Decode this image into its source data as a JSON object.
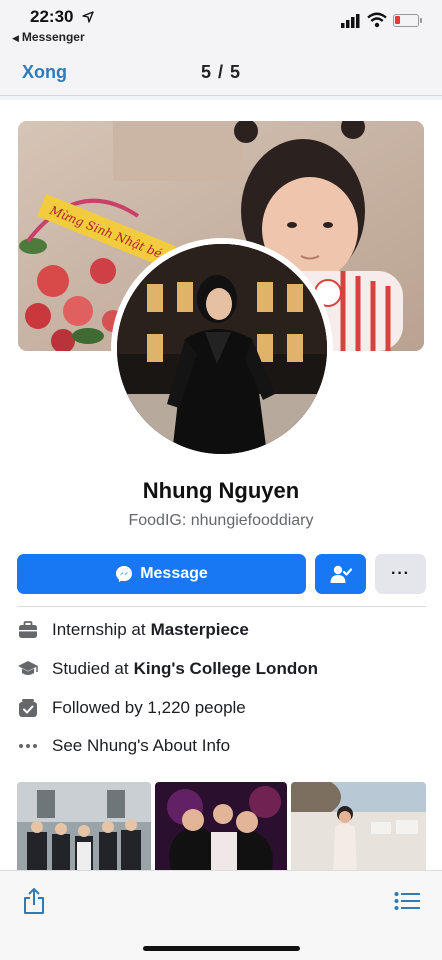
{
  "status_bar": {
    "time": "22:30",
    "back_app": "Messenger"
  },
  "nav": {
    "done_label": "Xong",
    "page_counter": "5 / 5"
  },
  "profile": {
    "name": "Nhung Nguyen",
    "bio": "FoodIG: nhungiefooddiary",
    "cover_banner_text": "Mừng Sinh Nhật bé"
  },
  "actions": {
    "message_label": "Message",
    "more_label": "···"
  },
  "info": {
    "work_prefix": "Internship at",
    "work_place": "Masterpiece",
    "study_prefix": "Studied at",
    "study_place": "King's College London",
    "followers": "Followed by 1,220 people",
    "about": "See Nhung's About Info"
  },
  "colors": {
    "accent": "#1877f2",
    "link": "#2f7bb8",
    "battery_low": "#e53935"
  },
  "icons": {
    "work": "briefcase-icon",
    "study": "graduation-cap-icon",
    "followers": "followers-icon",
    "about": "more-dots-icon",
    "share": "share-icon",
    "list": "list-icon"
  }
}
